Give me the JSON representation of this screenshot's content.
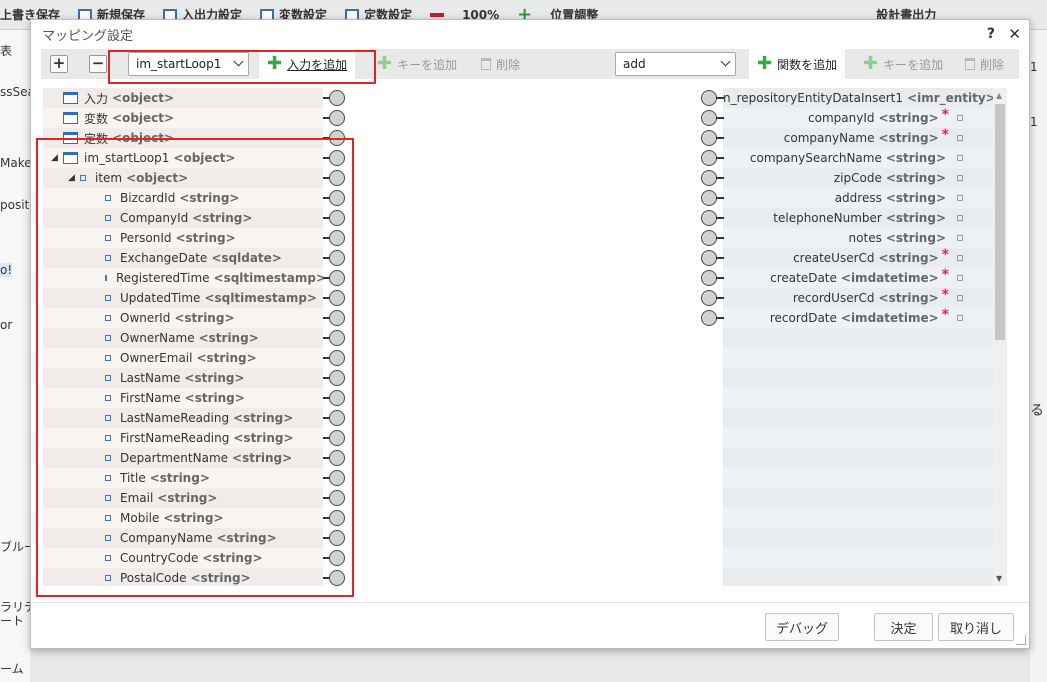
{
  "background": {
    "toolbar": [
      "上書き保存",
      "新規保存",
      "入出力設定",
      "変数設定",
      "定数設定",
      "100%",
      "位置調整",
      "設計書出力"
    ],
    "left_labels": [
      "表",
      "ssSear",
      "Maker",
      "positor",
      "o!",
      "or",
      "ブルー",
      "ラリテ",
      "ート",
      "ーム"
    ],
    "right_labels": [
      "1",
      "1",
      "る"
    ]
  },
  "dialog": {
    "title": "マッピング設定",
    "help": "?",
    "close": "✕"
  },
  "toolbar": {
    "expand": "+",
    "collapse": "−",
    "input_select": "im_startLoop1",
    "add_input": "入力を追加",
    "add_key_left": "キーを追加",
    "delete_left": "削除",
    "function_select": "add",
    "add_function": "関数を追加",
    "add_key_right": "キーを追加",
    "delete_right": "削除"
  },
  "left_tree": [
    {
      "name": "入力",
      "type": "<object>"
    },
    {
      "name": "変数",
      "type": "<object>"
    },
    {
      "name": "定数",
      "type": "<object>"
    },
    {
      "name": "im_startLoop1",
      "type": "<object>"
    },
    {
      "name": "item",
      "type": "<object>"
    },
    {
      "name": "BizcardId",
      "type": "<string>"
    },
    {
      "name": "CompanyId",
      "type": "<string>"
    },
    {
      "name": "PersonId",
      "type": "<string>"
    },
    {
      "name": "ExchangeDate",
      "type": "<sqldate>"
    },
    {
      "name": "RegisteredTime",
      "type": "<sqltimestamp>"
    },
    {
      "name": "UpdatedTime",
      "type": "<sqltimestamp>"
    },
    {
      "name": "OwnerId",
      "type": "<string>"
    },
    {
      "name": "OwnerName",
      "type": "<string>"
    },
    {
      "name": "OwnerEmail",
      "type": "<string>"
    },
    {
      "name": "LastName",
      "type": "<string>"
    },
    {
      "name": "FirstName",
      "type": "<string>"
    },
    {
      "name": "LastNameReading",
      "type": "<string>"
    },
    {
      "name": "FirstNameReading",
      "type": "<string>"
    },
    {
      "name": "DepartmentName",
      "type": "<string>"
    },
    {
      "name": "Title",
      "type": "<string>"
    },
    {
      "name": "Email",
      "type": "<string>"
    },
    {
      "name": "Mobile",
      "type": "<string>"
    },
    {
      "name": "CompanyName",
      "type": "<string>"
    },
    {
      "name": "CountryCode",
      "type": "<string>"
    },
    {
      "name": "PostalCode",
      "type": "<string>"
    }
  ],
  "right_tree": [
    {
      "name": "n_repositoryEntityDataInsert1",
      "type": "<imr_entity>",
      "required": ""
    },
    {
      "name": "companyId",
      "type": "<string>",
      "required": "*"
    },
    {
      "name": "companyName",
      "type": "<string>",
      "required": "*"
    },
    {
      "name": "companySearchName",
      "type": "<string>",
      "required": ""
    },
    {
      "name": "zipCode",
      "type": "<string>",
      "required": ""
    },
    {
      "name": "address",
      "type": "<string>",
      "required": ""
    },
    {
      "name": "telephoneNumber",
      "type": "<string>",
      "required": ""
    },
    {
      "name": "notes",
      "type": "<string>",
      "required": ""
    },
    {
      "name": "createUserCd",
      "type": "<string>",
      "required": "*"
    },
    {
      "name": "createDate",
      "type": "<imdatetime>",
      "required": "*"
    },
    {
      "name": "recordUserCd",
      "type": "<string>",
      "required": "*"
    },
    {
      "name": "recordDate",
      "type": "<imdatetime>",
      "required": "*"
    }
  ],
  "footer": {
    "debug": "デバッグ",
    "ok": "決定",
    "cancel": "取り消し"
  },
  "colors": {
    "highlight": "#e02525",
    "add_green": "#38a845",
    "required_star": "#e0245e",
    "object_icon": "#2f6eb8"
  }
}
